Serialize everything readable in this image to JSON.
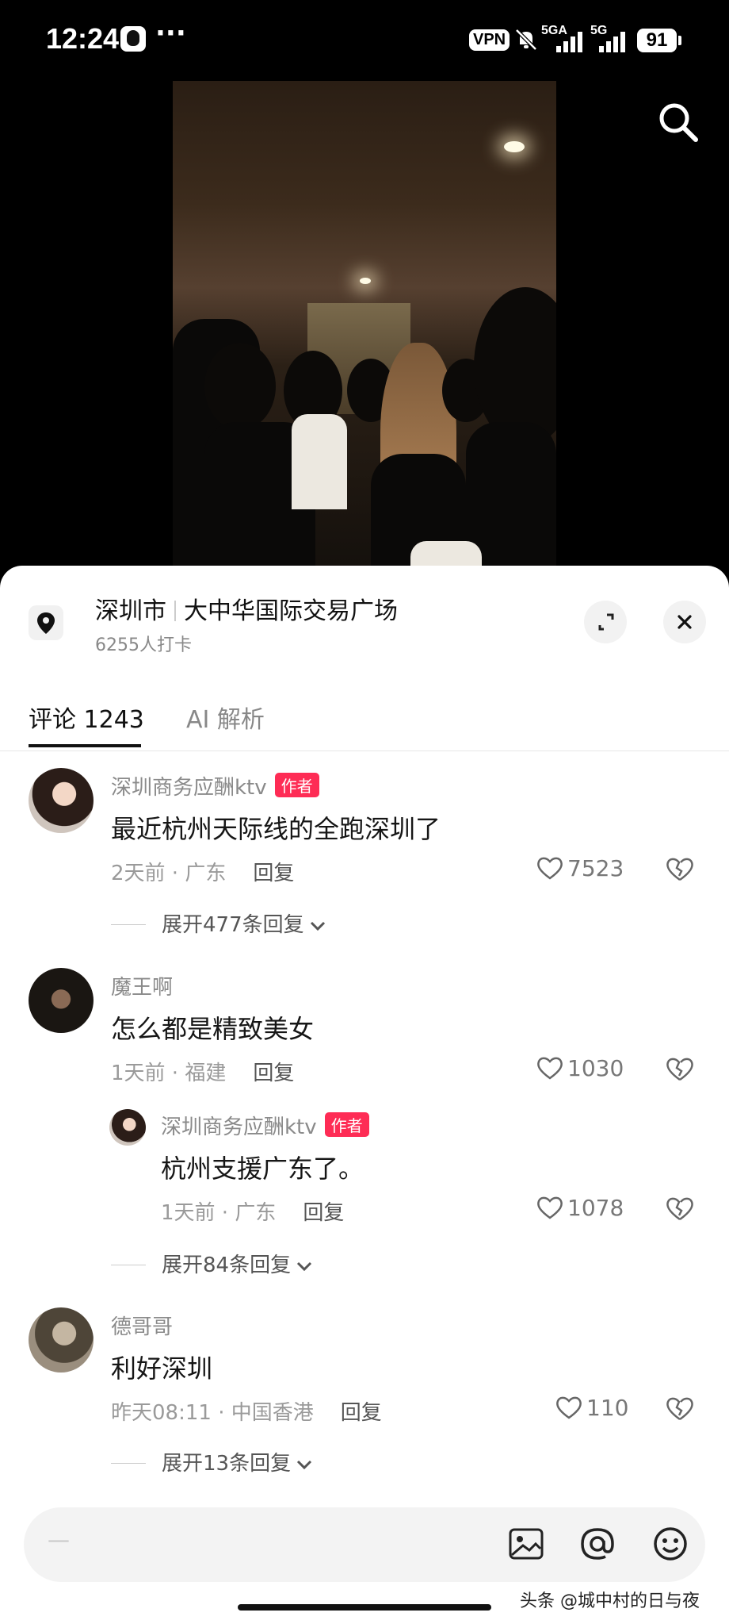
{
  "status_bar": {
    "time": "12:24",
    "vpn": "VPN",
    "sig1": "5GA",
    "sig2": "5G",
    "battery": "91"
  },
  "location": {
    "city": "深圳市",
    "place": "大中华国际交易广场",
    "checkins": "6255人打卡"
  },
  "tabs": {
    "comments": "评论 1243",
    "ai": "AI 解析"
  },
  "comments": [
    {
      "user": "深圳商务应酬ktv",
      "badge": "作者",
      "text": "最近杭州天际线的全跑深圳了",
      "time": "2天前",
      "region": "广东",
      "reply": "回复",
      "likes": "7523",
      "expand": "展开477条回复"
    },
    {
      "user": "魔王啊",
      "text": "怎么都是精致美女",
      "time": "1天前",
      "region": "福建",
      "reply": "回复",
      "likes": "1030",
      "sub": {
        "user": "深圳商务应酬ktv",
        "badge": "作者",
        "text": "杭州支援广东了。",
        "time": "1天前",
        "region": "广东",
        "reply": "回复",
        "likes": "1078"
      },
      "expand": "展开84条回复"
    },
    {
      "user": "德哥哥",
      "text": "利好深圳",
      "time": "昨天08:11",
      "region": "中国香港",
      "reply": "回复",
      "likes": "110",
      "expand": "展开13条回复"
    }
  ],
  "input": {
    "placeholder": "—"
  },
  "watermark": "头条 @城中村的日与夜",
  "icons": [
    "search-icon",
    "location-pin-icon",
    "expand-icon",
    "close-icon",
    "heart-icon",
    "dislike-icon",
    "chevron-down-icon",
    "image-icon",
    "at-icon",
    "emoji-icon"
  ]
}
